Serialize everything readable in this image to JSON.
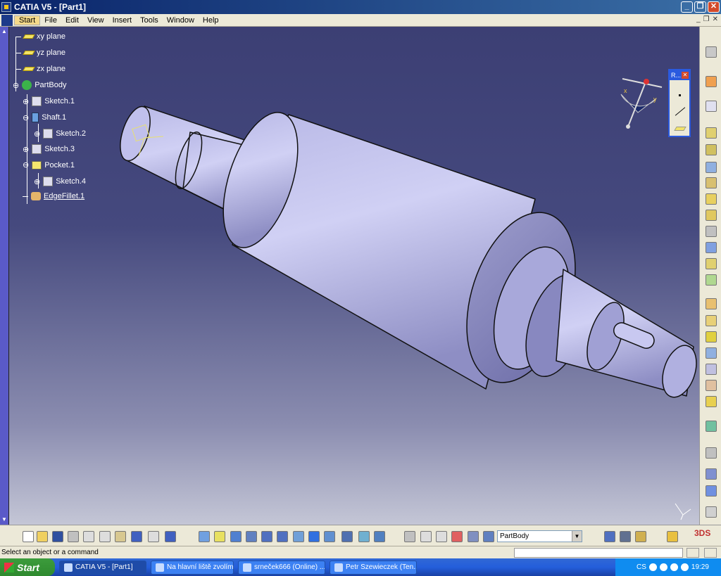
{
  "window": {
    "title": "CATIA V5 - [Part1]"
  },
  "menu": [
    "Start",
    "File",
    "Edit",
    "View",
    "Insert",
    "Tools",
    "Window",
    "Help"
  ],
  "tree": [
    {
      "label": "xy plane",
      "icon": "plane-icon"
    },
    {
      "label": "yz plane",
      "icon": "plane-icon"
    },
    {
      "label": "zx plane",
      "icon": "plane-icon"
    },
    {
      "label": "PartBody",
      "icon": "partbody-icon"
    },
    {
      "label": "Sketch.1",
      "icon": "sketch-icon"
    },
    {
      "label": "Shaft.1",
      "icon": "shaft-icon"
    },
    {
      "label": "Sketch.2",
      "icon": "sketch-icon"
    },
    {
      "label": "Sketch.3",
      "icon": "sketch-icon"
    },
    {
      "label": "Pocket.1",
      "icon": "pocket-icon"
    },
    {
      "label": "Sketch.4",
      "icon": "sketch-icon"
    },
    {
      "label": "EdgeFillet.1",
      "icon": "edgefillet-icon"
    }
  ],
  "reference_panel": {
    "title": "R..."
  },
  "combo": {
    "value": "PartBody"
  },
  "status": {
    "text": "Select an object or a command"
  },
  "taskbar": {
    "start": "Start",
    "items": [
      {
        "label": "CATIA V5 - [Part1]",
        "active": true
      },
      {
        "label": "Na hlavní liště zvolím ...",
        "active": false
      },
      {
        "label": "srneček666 (Online) ...",
        "active": false
      },
      {
        "label": "Petr Szewieczek (Ten...",
        "active": false
      }
    ],
    "lang": "CS",
    "clock": "19:29"
  },
  "compass_axes": {
    "x": "x",
    "y": "y",
    "z": "z"
  },
  "colors": {
    "viewport_top": "#3c3f74",
    "viewport_bottom": "#c4c6d6",
    "part": "#c8c8f0",
    "titlebar": "#0a246a"
  }
}
